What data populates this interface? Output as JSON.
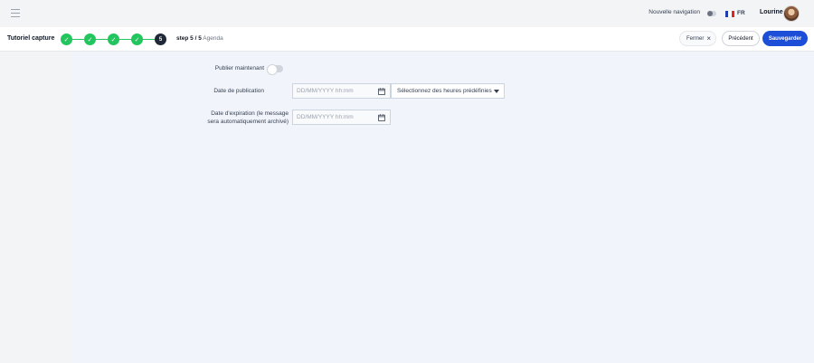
{
  "topbar": {
    "nav_toggle_label": "Nouvelle navigation",
    "language": "FR",
    "username": "Lourine"
  },
  "stepbar": {
    "title": "Tutoriel capture",
    "steps": [
      "✓",
      "✓",
      "✓",
      "✓",
      "5"
    ],
    "current_step_label": "step 5 / 5",
    "current_step_name": "Agenda",
    "close_label": "Fermer",
    "close_icon": "×",
    "prev_label": "Précédent",
    "save_label": "Sauvegarder"
  },
  "form": {
    "publish_now_label": "Publier maintenant",
    "publish_now_on": false,
    "publication_date_label": "Date de publication",
    "publication_date_placeholder": "DD/MM/YYYY hh:mm",
    "preset_hours_label": "Sélectionnez des heures prédéfinies",
    "expiration_label_line1": "Date d'expiration (le message",
    "expiration_label_line2": "sera automatiquement archivé)",
    "expiration_date_placeholder": "DD/MM/YYYY hh:mm"
  },
  "colors": {
    "done_step": "#22c55e",
    "current_step": "#1f2937",
    "primary": "#1d4ed8",
    "main_bg": "#f1f4fb"
  }
}
